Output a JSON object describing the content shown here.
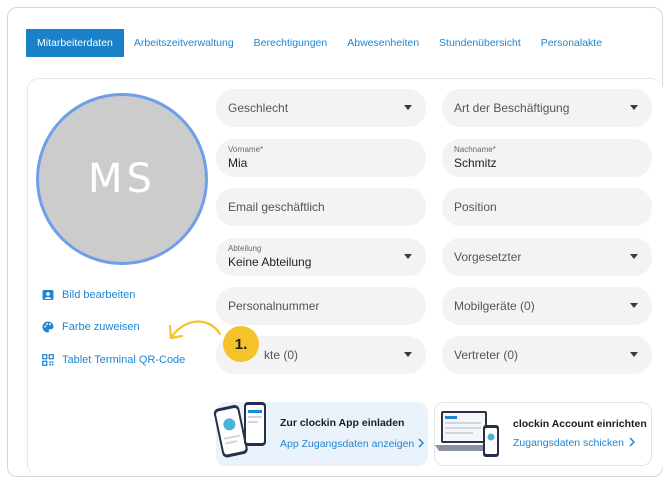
{
  "tabs": [
    {
      "label": "Mitarbeiterdaten",
      "active": true
    },
    {
      "label": "Arbeitszeitverwaltung",
      "active": false
    },
    {
      "label": "Berechtigungen",
      "active": false
    },
    {
      "label": "Abwesenheiten",
      "active": false
    },
    {
      "label": "Stundenübersicht",
      "active": false
    },
    {
      "label": "Personalakte",
      "active": false
    }
  ],
  "profile": {
    "initials": "MS",
    "avatar_color": "#cccccc",
    "avatar_ring_color": "#6e9fe8"
  },
  "side_links": [
    {
      "label": "Bild bearbeiten",
      "icon": "image-icon"
    },
    {
      "label": "Farbe zuweisen",
      "icon": "palette-icon"
    },
    {
      "label": "Tablet Terminal QR-Code",
      "icon": "qr-code-icon"
    }
  ],
  "fields": {
    "geschlecht": {
      "placeholder": "Geschlecht"
    },
    "beschaeftigung": {
      "placeholder": "Art der Beschäftigung"
    },
    "vorname": {
      "label": "Vorname*",
      "value": "Mia"
    },
    "nachname": {
      "label": "Nachname*",
      "value": "Schmitz"
    },
    "email": {
      "placeholder": "Email geschäftlich"
    },
    "position": {
      "placeholder": "Position"
    },
    "abteilung": {
      "label": "Abteilung",
      "value": "Keine Abteilung"
    },
    "vorgesetzter": {
      "placeholder": "Vorgesetzter"
    },
    "personalnummer": {
      "placeholder": "Personalnummer"
    },
    "mobilgeraete": {
      "placeholder": "Mobilgeräte (0)"
    },
    "karte": {
      "placeholder": "kte (0)"
    },
    "vertreter": {
      "placeholder": "Vertreter (0)"
    }
  },
  "callout": {
    "step": "1.",
    "color": "#f4c22b"
  },
  "promos": [
    {
      "title": "Zur clockin App einladen",
      "link": "App Zugangsdaten anzeigen"
    },
    {
      "title": "clockin Account einrichten",
      "link": "Zugangsdaten schicken"
    }
  ],
  "colors": {
    "accent": "#1f86d0",
    "tab_active_bg": "#1a80c8",
    "field_bg": "#f3f3f3"
  }
}
